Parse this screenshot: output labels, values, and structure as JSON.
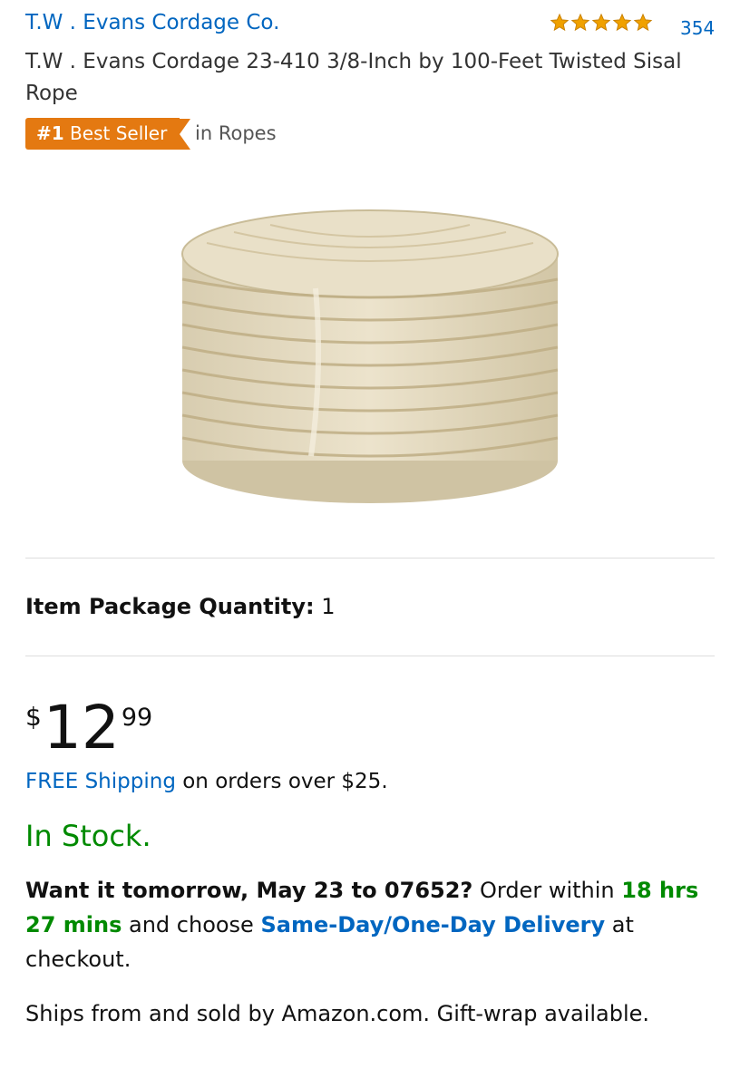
{
  "header": {
    "brand": "T.W . Evans Cordage Co.",
    "rating_stars": 5,
    "review_count": "354",
    "title": "T.W . Evans Cordage 23-410 3/8-Inch by 100-Feet Twisted Sisal Rope"
  },
  "badge": {
    "rank": "#1",
    "label": "Best Seller",
    "category": "in Ropes"
  },
  "quantity": {
    "label": "Item Package Quantity:",
    "value": "1"
  },
  "price": {
    "symbol": "$",
    "whole": "12",
    "fraction": "99"
  },
  "shipping": {
    "link": "FREE Shipping",
    "rest": "on orders over $25."
  },
  "stock": "In Stock.",
  "delivery": {
    "want": "Want it tomorrow, May 23 to 07652?",
    "order_within": "Order within",
    "time": "18 hrs 27 mins",
    "and_choose": "and choose",
    "option": "Same-Day/One-Day Delivery",
    "at_checkout": "at checkout."
  },
  "ships_from": "Ships from and sold by Amazon.com. Gift-wrap available.",
  "colors": {
    "link": "#0066c0",
    "badge": "#e47911",
    "stock": "#008a00",
    "star": "#f0a100"
  }
}
